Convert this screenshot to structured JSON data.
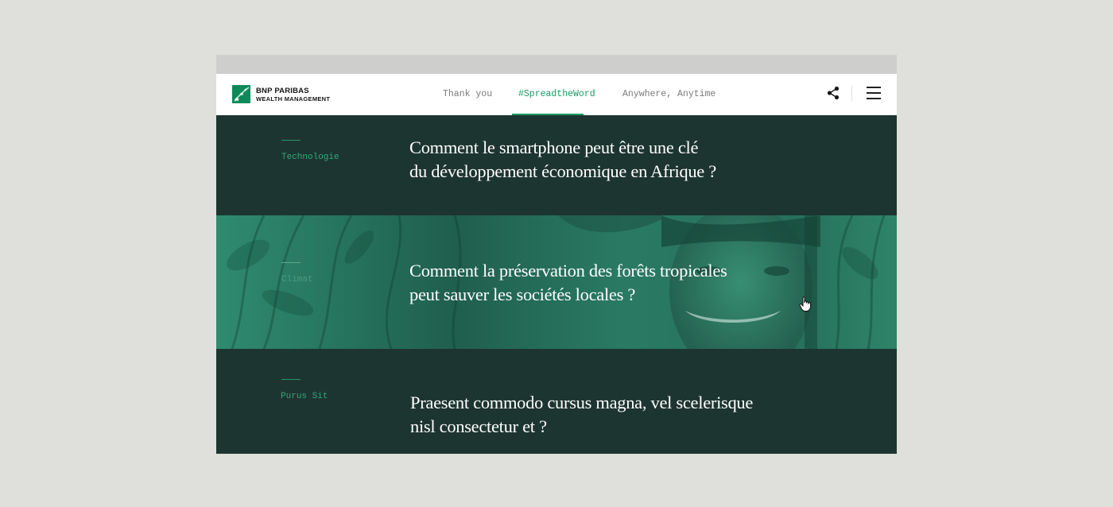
{
  "brand": {
    "line1": "BNP PARIBAS",
    "line2": "WEALTH MANAGEMENT",
    "logo_icon": "bnp-stars-logo-icon",
    "color": "#0d8a5a"
  },
  "nav": {
    "items": [
      {
        "label": "Thank you",
        "active": false
      },
      {
        "label": "#SpreadtheWord",
        "active": true
      },
      {
        "label": "Anywhere, Anytime",
        "active": false
      }
    ],
    "accent": "#1a9a65"
  },
  "header_actions": {
    "share_icon": "share-icon",
    "menu_icon": "hamburger-menu-icon"
  },
  "articles": [
    {
      "category": "Technologie",
      "title_lines": [
        "Comment le smartphone peut être une clé",
        "du développement économique en Afrique ?"
      ]
    },
    {
      "category": "Climat",
      "title_lines": [
        "Comment la préservation des forêts tropicales",
        "peut sauver les sociétés locales ?"
      ],
      "image": "green-tinted-photo-woman-smiling-forest"
    },
    {
      "category": "Purus Sit",
      "title_lines": [
        "Praesent commodo cursus magna, vel scelerisque",
        "nisl consectetur et ?"
      ]
    }
  ],
  "cursor_icon": "hand-pointer-cursor-icon",
  "colors": {
    "page_bg": "#dfdfdb",
    "dark_green": "#1d3530",
    "photo_tint": "#2a7a63"
  }
}
